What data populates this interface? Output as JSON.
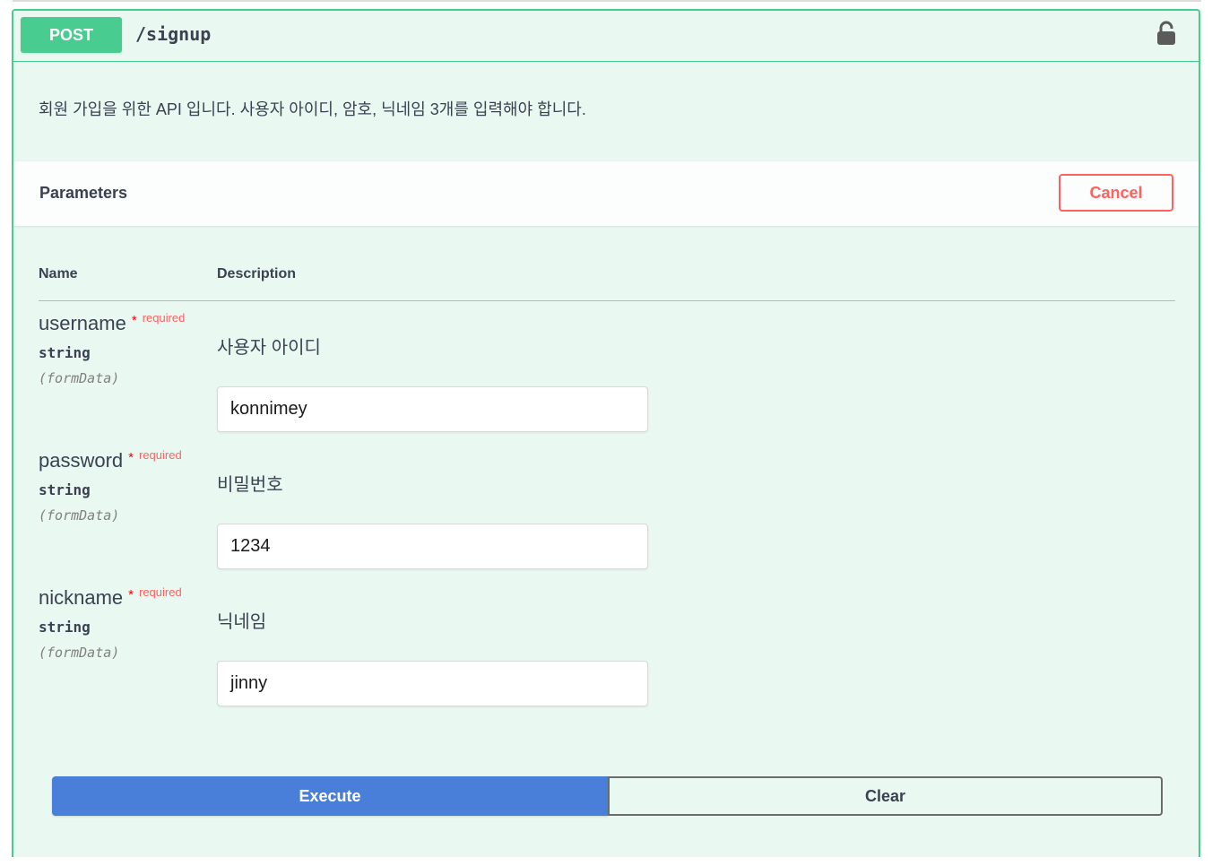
{
  "endpoint": {
    "method": "POST",
    "path": "/signup",
    "lock_icon": "lock-icon",
    "description": "회원 가입을 위한 API 입니다. 사용자 아이디, 암호, 닉네임 3개를 입력해야 합니다."
  },
  "parameters": {
    "title": "Parameters",
    "cancel_label": "Cancel",
    "columns": {
      "name": "Name",
      "description": "Description"
    },
    "items": [
      {
        "name": "username",
        "star": "*",
        "required": "required",
        "type": "string",
        "in": "(formData)",
        "description": "사용자 아이디",
        "value": "konnimey"
      },
      {
        "name": "password",
        "star": "*",
        "required": "required",
        "type": "string",
        "in": "(formData)",
        "description": "비밀번호",
        "value": "1234"
      },
      {
        "name": "nickname",
        "star": "*",
        "required": "required",
        "type": "string",
        "in": "(formData)",
        "description": "닉네임",
        "value": "jinny"
      }
    ]
  },
  "actions": {
    "execute_label": "Execute",
    "clear_label": "Clear"
  },
  "colors": {
    "post_green": "#49cc90",
    "cancel_red": "#ff6060",
    "execute_blue": "#4a7fd9"
  }
}
